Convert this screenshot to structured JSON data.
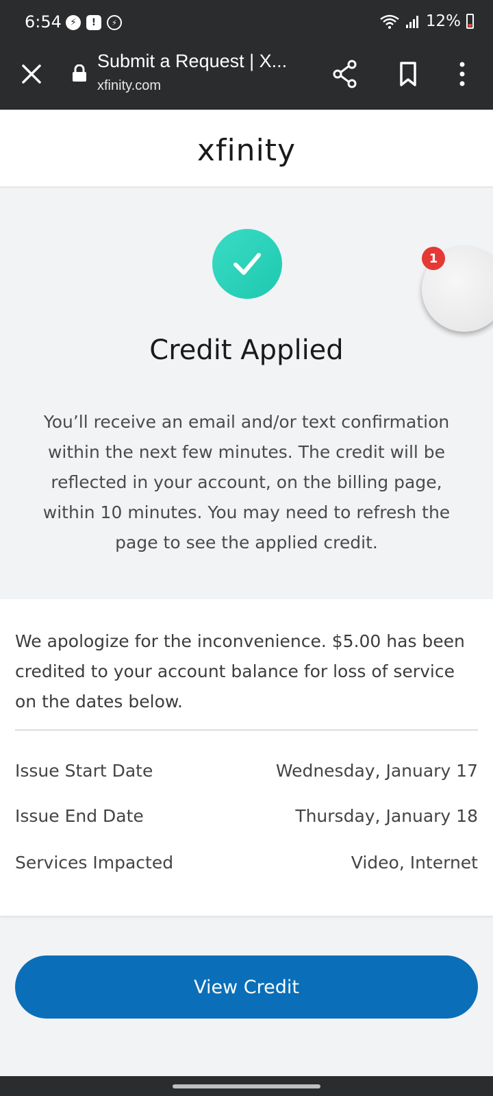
{
  "status_bar": {
    "time": "6:54",
    "battery": "12%",
    "icons": [
      "messenger-icon",
      "alert-icon",
      "messenger-outline-icon",
      "wifi-icon",
      "signal-icon",
      "battery-icon"
    ]
  },
  "browser": {
    "title": "Submit a Request | X...",
    "url": "xfinity.com"
  },
  "header": {
    "logo": "xfinity"
  },
  "hero": {
    "title": "Credit Applied",
    "description": "You’ll receive an email and/or text confirmation within the next few minutes. The credit will be reflected in your account, on the billing page, within 10 minutes. You may need to refresh the page to see the applied credit."
  },
  "floating_bubble": {
    "badge": "1"
  },
  "details": {
    "apology": "We apologize for the inconvenience. $5.00 has been credited to your account balance for loss of service on the dates below.",
    "rows": [
      {
        "label": "Issue Start Date",
        "value": "Wednesday, January 17"
      },
      {
        "label": "Issue End Date",
        "value": "Thursday, January 18"
      },
      {
        "label": "Services Impacted",
        "value": "Video, Internet"
      }
    ]
  },
  "actions": {
    "view_credit": "View Credit"
  },
  "colors": {
    "accent": "#0a6fb8",
    "success": "#2fd3bb",
    "badge": "#e53935"
  }
}
